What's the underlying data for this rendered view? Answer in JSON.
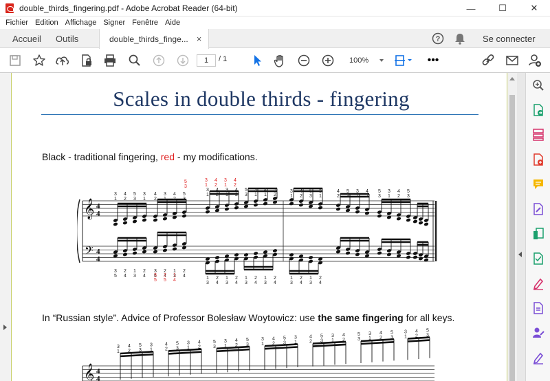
{
  "window": {
    "title": "double_thirds_fingering.pdf - Adobe Acrobat Reader (64-bit)",
    "minimize": "—",
    "maximize": "☐",
    "close": "✕"
  },
  "menu": [
    "Fichier",
    "Edition",
    "Affichage",
    "Signer",
    "Fenêtre",
    "Aide"
  ],
  "tabs": {
    "home": "Accueil",
    "tools": "Outils",
    "document": "double_thirds_finge...",
    "close_glyph": "×",
    "help_glyph": "?",
    "sign_in": "Se connecter"
  },
  "toolbar": {
    "page_current": "1",
    "page_total": "/ 1",
    "zoom": "100%",
    "more": "•••"
  },
  "document": {
    "title": "Scales in double thirds - fingering",
    "line1_prefix": "Black - traditional fingering, ",
    "line1_red": "red",
    "line1_suffix": " - my modifications.",
    "line2_prefix": "In “Russian style”. Advice of Professor Bolesław Woytowicz: use ",
    "line2_bold": "the same fingering",
    "line2_suffix": " for all keys."
  },
  "colors": {
    "title_blue": "#1f3864",
    "rule_blue": "#2e75b6",
    "red": "#e02020",
    "tool_blue": "#1473e6"
  },
  "icons": {
    "toolbar": [
      "save-icon",
      "star-icon",
      "upload-icon",
      "lock-document-icon",
      "print-icon",
      "search-icon",
      "page-up-icon",
      "page-down-icon",
      "select-arrow-icon",
      "hand-icon",
      "zoom-out-icon",
      "zoom-in-icon",
      "fit-page-icon",
      "share-link-icon",
      "mail-icon",
      "add-user-icon"
    ],
    "sidepanel": [
      "zoom-icon",
      "export-pdf-icon",
      "organize-pages-icon",
      "create-pdf-icon",
      "comment-icon",
      "edit-pdf-icon",
      "compress-icon",
      "scan-icon",
      "fill-sign-icon",
      "protect-icon",
      "send-sign-icon",
      "more-tools-icon"
    ]
  }
}
